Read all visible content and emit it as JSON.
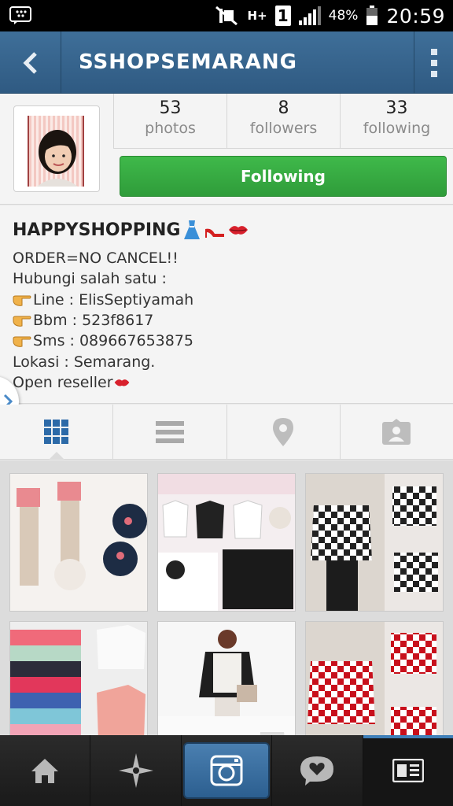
{
  "status_bar": {
    "signal_text": "H+",
    "sim": "1",
    "battery_percent": "48%",
    "time": "20:59"
  },
  "header": {
    "title": "SSHOPSEMARANG"
  },
  "stats": {
    "photos_count": "53",
    "photos_label": "photos",
    "followers_count": "8",
    "followers_label": "followers",
    "following_count": "33",
    "following_label": "following"
  },
  "follow_button": {
    "label": "Following"
  },
  "bio": {
    "name": "HAPPYSHOPPING",
    "lines": [
      "ORDER=NO CANCEL!!",
      "Hubungi salah satu :",
      "Line : ElisSeptiyamah",
      "Bbm : 523f8617",
      "Sms : 089667653875",
      "Lokasi : Semarang.",
      "Open reseller"
    ]
  },
  "tabs": [
    "grid-icon",
    "list-icon",
    "location-pin-icon",
    "tagged-photos-icon"
  ],
  "bottom_nav": [
    "home-icon",
    "explore-icon",
    "camera-icon",
    "activity-icon",
    "profile-news-icon"
  ],
  "colors": {
    "header_blue": "#3a6894",
    "follow_green": "#36ad42",
    "active_tab_blue": "#2c6aa8"
  }
}
